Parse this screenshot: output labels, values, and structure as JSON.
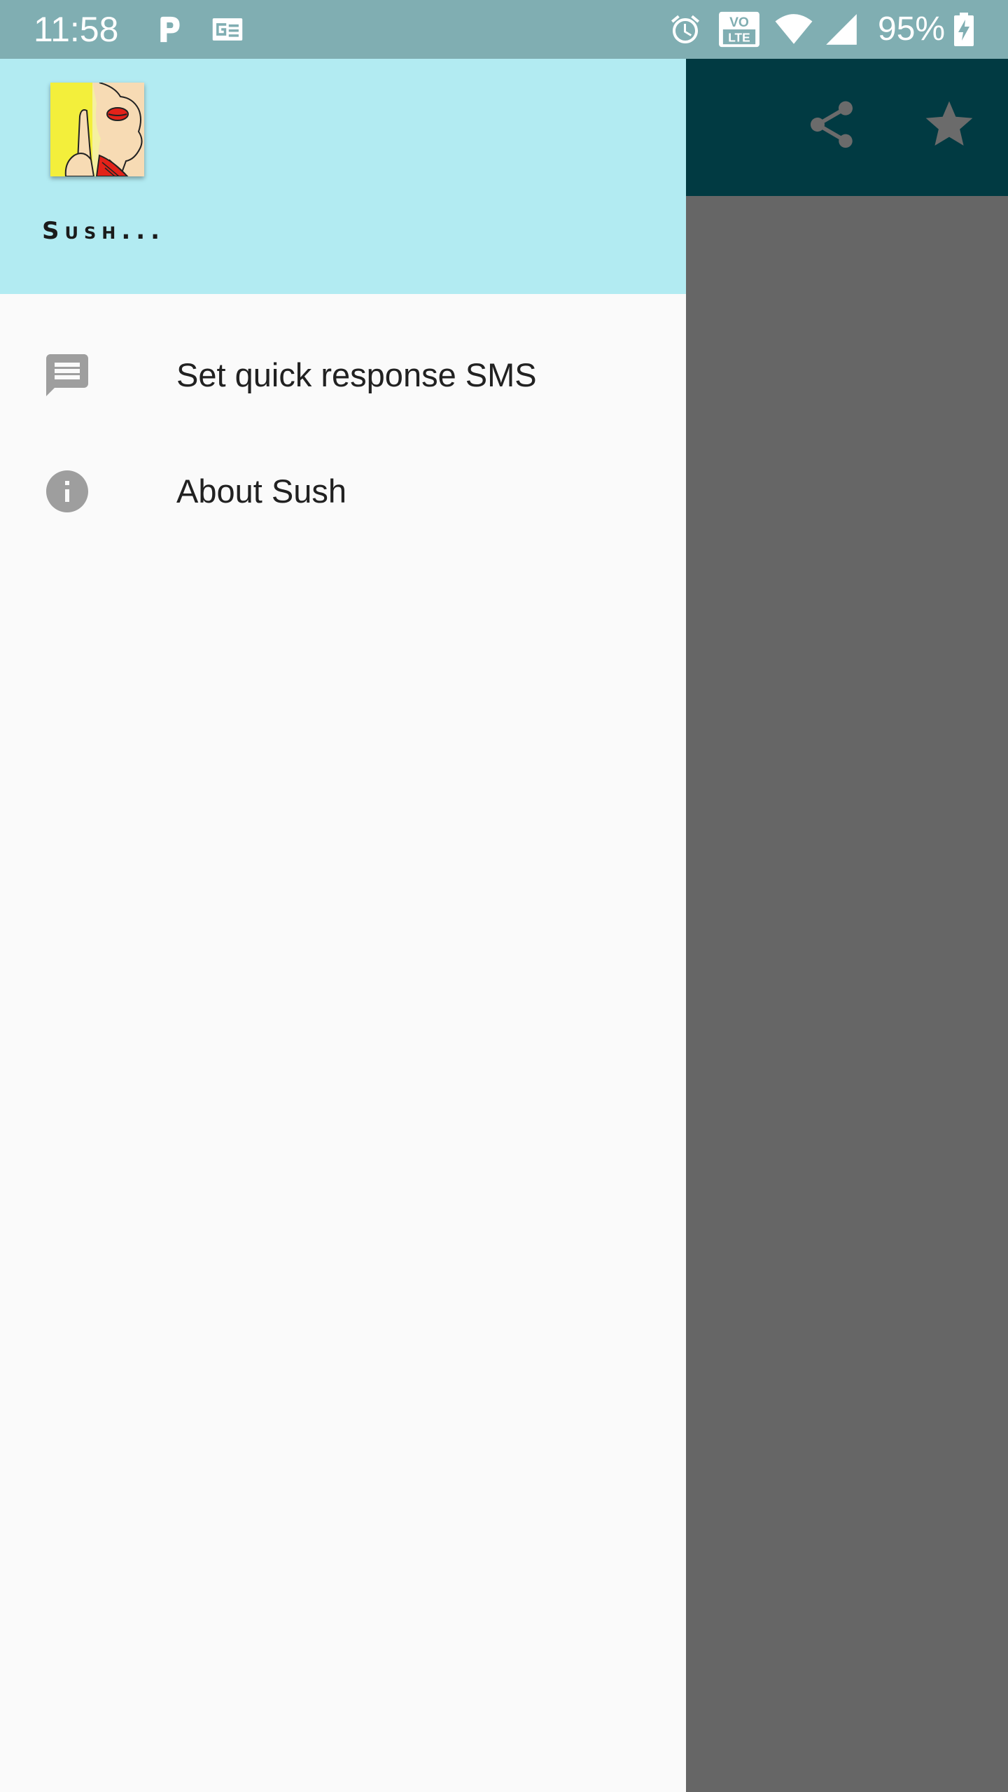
{
  "status_bar": {
    "time": "11:58",
    "battery_percent": "95%",
    "icons": [
      "parking-icon",
      "news-icon",
      "alarm-icon",
      "volte-icon",
      "wifi-icon",
      "signal-icon",
      "battery-charging-icon"
    ],
    "volte_top": "VO",
    "volte_bottom": "LTE"
  },
  "toolbar": {
    "actions": [
      "share-icon",
      "star-icon"
    ]
  },
  "drawer": {
    "app_name": "Sush...",
    "menu": [
      {
        "label": "Set quick response SMS",
        "icon": "message-icon"
      },
      {
        "label": "About Sush",
        "icon": "info-icon"
      }
    ]
  },
  "colors": {
    "status_bar": "#80aeb2",
    "toolbar": "#013a42",
    "drawer_header": "#b2ebf2",
    "drawer_body": "#fafafa",
    "scrim_content": "#666666",
    "menu_icon": "#9e9e9e",
    "menu_text": "#212121"
  }
}
